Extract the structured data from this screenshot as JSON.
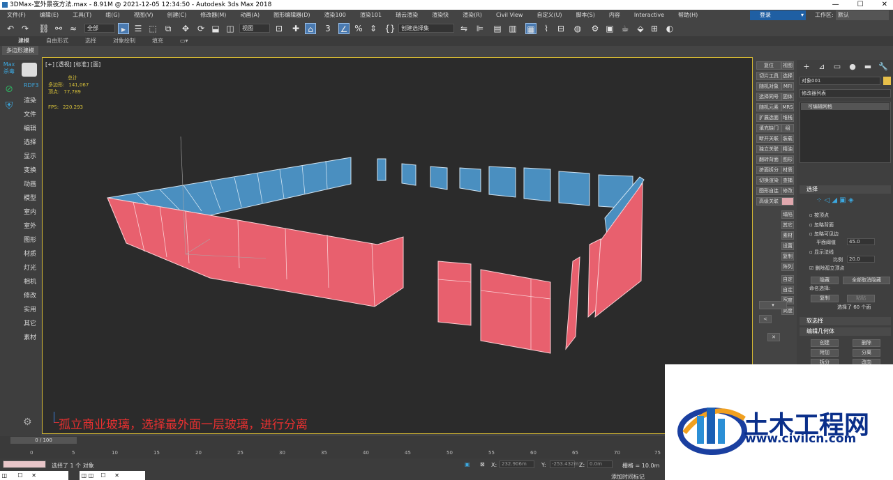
{
  "window": {
    "title": "3DMax-室外景夜方法.max - 8.91M @ 2021-12-05 12:34:50 - Autodesk 3ds Max 2018",
    "controls": [
      "—",
      "☐",
      "✕"
    ]
  },
  "menu": [
    "文件(F)",
    "编辑(E)",
    "工具(T)",
    "组(G)",
    "视图(V)",
    "创建(C)",
    "修改器(M)",
    "动画(A)",
    "图形编辑器(D)",
    "渲染100",
    "渲染101",
    "瑞云渲染",
    "渲染快",
    "渲染(R)",
    "Civil View",
    "自定义(U)",
    "脚本(S)",
    "内容",
    "Interactive",
    "帮助(H)"
  ],
  "account": {
    "login": "登录",
    "workspace_label": "工作区:",
    "workspace_value": "默认"
  },
  "toolbar": {
    "filter": "全部",
    "ref_coord": "视图",
    "selection_set": "创建选择集"
  },
  "ribbon": {
    "tabs": [
      "建模",
      "自由形式",
      "选择",
      "对象绘制",
      "填充"
    ],
    "active": "建模",
    "subtab": "多边形建模"
  },
  "left_bar": {
    "items": [
      "Max 杀毒",
      "RDF3"
    ]
  },
  "left_col": {
    "items": [
      "渲染",
      "文件",
      "编辑",
      "选择",
      "显示",
      "变换",
      "动画",
      "模型",
      "室内",
      "室外",
      "图形",
      "材质",
      "灯光",
      "相机",
      "修改",
      "实用",
      "其它",
      "素材"
    ]
  },
  "viewport": {
    "label": "[+] [透视] [标准] [面]",
    "stats": {
      "total_label": "总计",
      "poly_label": "多边形:",
      "poly_value": "141,067",
      "vert_label": "顶点:",
      "vert_value": "77,789",
      "fps_label": "FPS:",
      "fps_value": "220.293"
    },
    "caption": "孤立商业玻璃，选择最外面一层玻璃，进行分离"
  },
  "right_panel": {
    "buttons": [
      "复位",
      "切片工具",
      "随机对象",
      "选择同号",
      "随机元素",
      "扩展选面",
      "填充缺门",
      "断开关联",
      "独立关联",
      "翻转背面",
      "挤面拆分",
      "切换渲染",
      "图形自连",
      "高级关联"
    ],
    "short": [
      "视图",
      "选择",
      "MFI",
      "固体",
      "MRS",
      "堆栈",
      "组",
      "装载",
      "精油",
      "图形",
      "材质",
      "查捕",
      "修改",
      "",
      "塌陷",
      "其它",
      "素材",
      "设置",
      "复制",
      "阵列",
      "自定",
      "自定",
      "宽度",
      "高度"
    ]
  },
  "command_panel": {
    "tabs": [
      "+",
      "⊿",
      "▭",
      "●",
      "▬",
      "🔧"
    ],
    "object_name": "对象001",
    "modifier_list": "修改器列表",
    "stack_item": "可编辑网格",
    "selection_title": "选择",
    "options": [
      "按顶点",
      "忽略背面",
      "忽略可见边",
      "平面阈值",
      "显示法线",
      "比例",
      "删除孤立顶点"
    ],
    "threshold_value": "45.0",
    "scale_value": "20.0",
    "hide_btn": "隐藏",
    "unhide_btn": "全部取消隐藏",
    "named_sel": "命名选择:",
    "copy_btn": "复制",
    "paste_btn": "粘贴",
    "selected_text": "选择了 60 个面",
    "soft_sel": "软选择",
    "edit_geo": "编辑几何体",
    "create_btn": "创建",
    "delete_btn": "删除",
    "attach_btn": "附加",
    "detach_btn": "分离",
    "split_btn": "拆分",
    "turn_btn": "改向"
  },
  "timeline": {
    "position": "0 / 100",
    "ticks": [
      "0",
      "5",
      "10",
      "15",
      "20",
      "25",
      "30",
      "35",
      "40",
      "45",
      "50",
      "55",
      "60",
      "65",
      "70",
      "75"
    ]
  },
  "status": {
    "selected": "选择了 1 个 对象",
    "x_label": "X:",
    "x_value": "232.906m",
    "y_label": "Y:",
    "y_value": "-253.432m",
    "z_label": "Z:",
    "z_value": "0.0m",
    "grid": "栅格 = 10.0m",
    "add_time_tag": "添加时间标记"
  },
  "watermark": {
    "title": "土木工程网",
    "url": "www.civilcn.com"
  },
  "colors": {
    "pink_glass": "#e8606e",
    "blue_glass": "#4a8fc0",
    "accent": "#d4b833"
  }
}
